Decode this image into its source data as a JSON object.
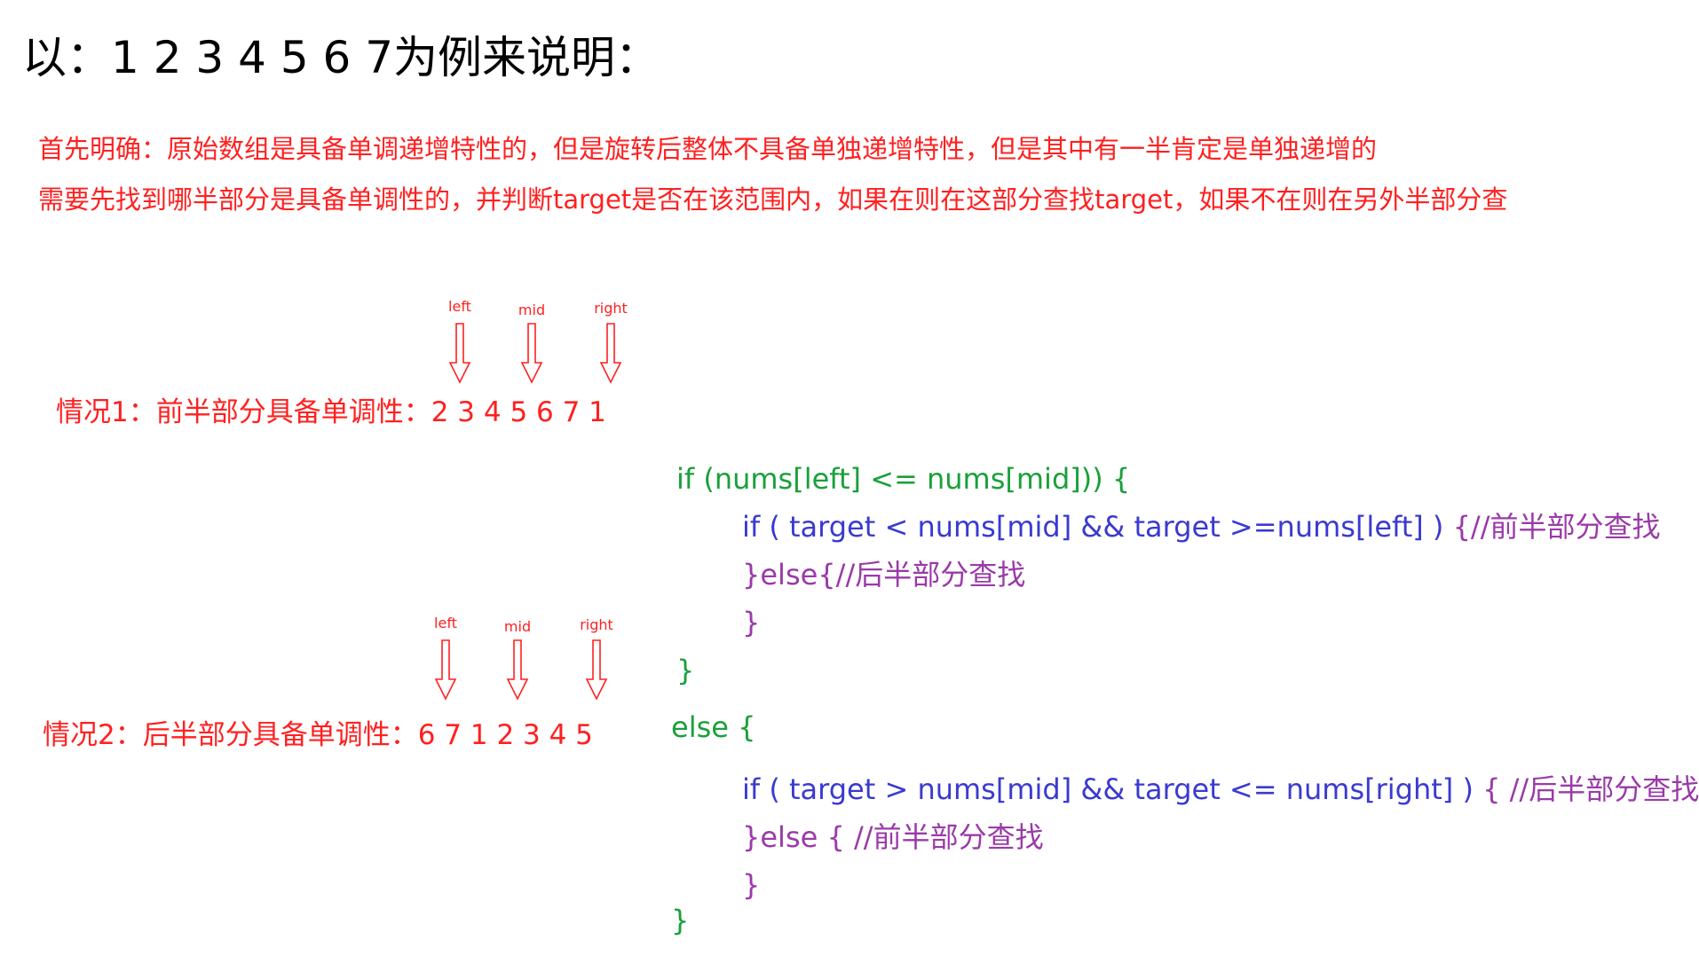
{
  "title": "以：1 2 3 4 5 6 7为例来说明：",
  "intro": {
    "line1": "首先明确：原始数组是具备单调递增特性的，但是旋转后整体不具备单独递增特性，但是其中有一半肯定是单独递增的",
    "line2": "需要先找到哪半部分是具备单调性的，并判断target是否在该范围内，如果在则在这部分查找target，如果不在则在另外半部分查"
  },
  "case1": {
    "label": "情况1：前半部分具备单调性：2 3 4 5 6 7 1",
    "pointers": [
      "left",
      "mid",
      "right"
    ]
  },
  "case2": {
    "label": "情况2：后半部分具备单调性：6 7 1 2 3 4 5",
    "pointers": [
      "left",
      "mid",
      "right"
    ]
  },
  "code": {
    "if_line": "if (nums[left]  <= nums[mid])) {",
    "inner1_cond": "if ( target < nums[mid] && target >=nums[left] ) ",
    "inner1_comment": "{//前半部分查找",
    "inner1_else": "}else{//后半部分查找",
    "inner1_close": "}",
    "if_close": "}",
    "else_line": "else {",
    "inner2_cond": "if ( target > nums[mid] && target <= nums[right] ) ",
    "inner2_comment": "{ //后半部分查找",
    "inner2_else_brace": "}",
    "inner2_else": "else { //前半部分查找",
    "inner2_close": "}",
    "else_close": "}"
  },
  "colors": {
    "title": "#000000",
    "note": "#ff2020",
    "outer_code": "#1aa03a",
    "condition": "#3a3ad0",
    "comment": "#9a3aa8"
  }
}
